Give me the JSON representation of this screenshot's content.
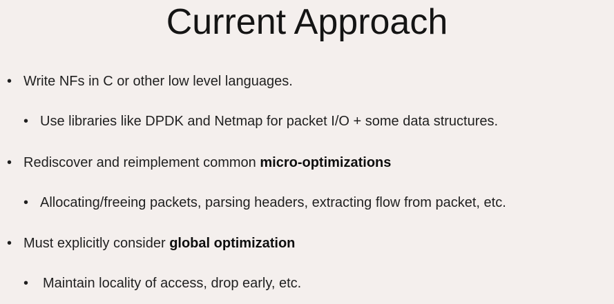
{
  "slide": {
    "title": "Current Approach",
    "bullet_symbol": "•",
    "bullets": [
      {
        "level": 1,
        "text": "Write NFs in C or other low level languages.",
        "bold": ""
      },
      {
        "level": 2,
        "text": "Use libraries like DPDK and Netmap for packet I/O + some data structures.",
        "bold": ""
      },
      {
        "level": 1,
        "text": "Rediscover and reimplement common ",
        "bold": "micro-optimizations"
      },
      {
        "level": 2,
        "text": "Allocating/freeing packets, parsing headers, extracting flow from packet, etc.",
        "bold": ""
      },
      {
        "level": 1,
        "text": "Must explicitly consider ",
        "bold": "global optimization"
      },
      {
        "level": 2,
        "text": "Maintain locality of access, drop early, etc.",
        "bold": ""
      }
    ]
  },
  "colors": {
    "background": "#f4efed",
    "text": "#1f1f1f"
  }
}
